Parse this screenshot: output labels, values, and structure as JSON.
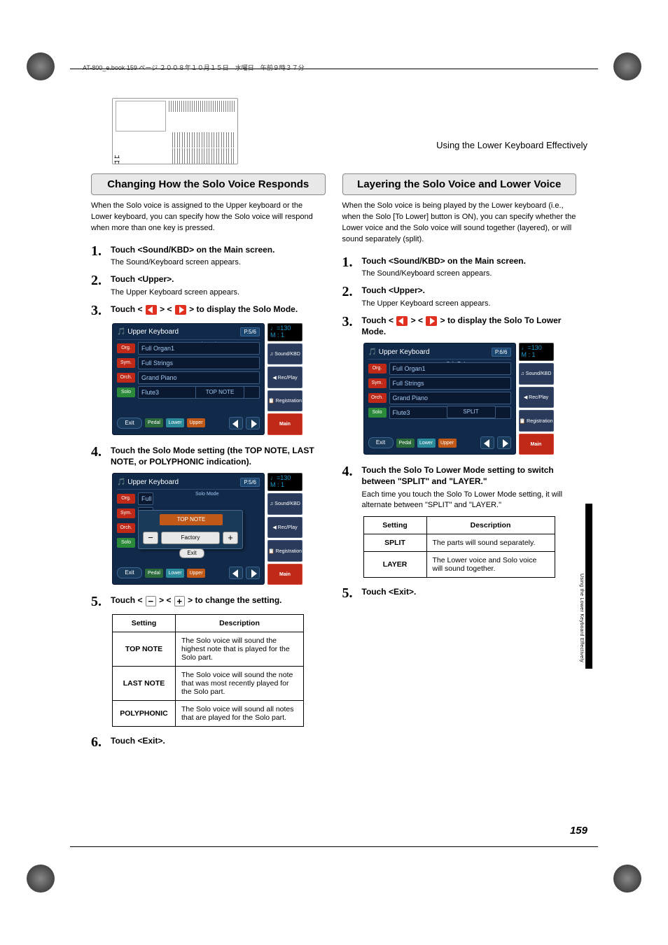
{
  "header_text": "AT-800_e.book  159 ページ  ２００８年１０月１５日　水曜日　午前９時３７分",
  "section_header": "Using the Lower Keyboard Effectively",
  "side_tab_text": "Using the Lower Keyboard Effectively",
  "page_number": "159",
  "left": {
    "title": "Changing How the Solo Voice Responds",
    "intro": "When the Solo voice is assigned to the Upper keyboard or the Lower keyboard, you can specify how the Solo voice will respond when more than one key is pressed.",
    "steps": [
      {
        "num": "1.",
        "title": "Touch <Sound/KBD> on the Main screen.",
        "body": "The Sound/Keyboard screen appears."
      },
      {
        "num": "2.",
        "title": "Touch <Upper>.",
        "body": "The Upper Keyboard screen appears."
      },
      {
        "num": "3.",
        "title_pre": "Touch < ",
        "title_mid": " > < ",
        "title_post": " > to display the Solo Mode."
      },
      {
        "num": "4.",
        "title": "Touch the Solo Mode setting (the TOP NOTE, LAST NOTE, or POLYPHONIC indication)."
      },
      {
        "num": "5.",
        "title_pre": "Touch < ",
        "title_mid": " > < ",
        "title_post": " > to change the setting."
      },
      {
        "num": "6.",
        "title": "Touch <Exit>."
      }
    ],
    "screenshot1": {
      "header_icon": "♪",
      "header_title": "Upper Keyboard",
      "page_badge": "P.5/6",
      "tempo": "♩=130",
      "tempo_m": "M :     1",
      "col_label": "Solo\nMode",
      "rows": [
        {
          "tag": "Org.",
          "tagclass": "tag-org",
          "voice": "Full Organ1"
        },
        {
          "tag": "Sym.",
          "tagclass": "tag-sym",
          "voice": "Full Strings"
        },
        {
          "tag": "Orch.",
          "tagclass": "tag-orch",
          "voice": "Grand Piano"
        },
        {
          "tag": "Solo",
          "tagclass": "tag-solo",
          "voice": "Flute3"
        }
      ],
      "value": "TOP NOTE",
      "exit": "Exit",
      "mini": {
        "pedal": "Pedal",
        "lower": "Lower",
        "upper": "Upper"
      },
      "side_buttons": [
        {
          "label": "♫ Sound/KBD"
        },
        {
          "label": "◀ Rec/Play"
        },
        {
          "label": "📋 Registration"
        }
      ],
      "main_btn": "Main"
    },
    "screenshot2_popup": {
      "value": "TOP NOTE",
      "factory": "Factory",
      "exit": "Exit"
    },
    "table": {
      "header_setting": "Setting",
      "header_desc": "Description",
      "rows": [
        {
          "key": "TOP NOTE",
          "desc": "The Solo voice will sound the highest note that is played for the Solo part."
        },
        {
          "key": "LAST NOTE",
          "desc": "The Solo voice will sound the note that was most recently played for the Solo part."
        },
        {
          "key": "POLYPHONIC",
          "desc": "The Solo voice will sound all notes that are played for the Solo part."
        }
      ]
    }
  },
  "right": {
    "title": "Layering the Solo Voice and Lower Voice",
    "intro": "When the Solo voice is being played by the Lower keyboard (i.e., when the Solo [To Lower] button is ON), you can specify whether the Lower voice and the Solo voice will sound together (layered), or will sound separately (split).",
    "steps": [
      {
        "num": "1.",
        "title": "Touch <Sound/KBD> on the Main screen.",
        "body": "The Sound/Keyboard screen appears."
      },
      {
        "num": "2.",
        "title": "Touch <Upper>.",
        "body": "The Upper Keyboard screen appears."
      },
      {
        "num": "3.",
        "title_pre": "Touch < ",
        "title_mid": " > < ",
        "title_post": " > to display the Solo To Lower Mode."
      },
      {
        "num": "4.",
        "title": "Touch the Solo To Lower Mode setting to switch between \"SPLIT\" and \"LAYER.\"",
        "body": "Each time you touch the Solo To Lower Mode setting, it will alternate between \"SPLIT\" and \"LAYER.\""
      },
      {
        "num": "5.",
        "title": "Touch <Exit>."
      }
    ],
    "screenshot": {
      "header_title": "Upper Keyboard",
      "page_badge": "P.6/6",
      "tempo": "♩=130",
      "tempo_m": "M :     1",
      "col_label": "Solo To Lower\nMode",
      "rows": [
        {
          "tag": "Org.",
          "tagclass": "tag-org",
          "voice": "Full Organ1"
        },
        {
          "tag": "Sym.",
          "tagclass": "tag-sym",
          "voice": "Full Strings"
        },
        {
          "tag": "Orch.",
          "tagclass": "tag-orch",
          "voice": "Grand Piano"
        },
        {
          "tag": "Solo",
          "tagclass": "tag-solo",
          "voice": "Flute3"
        }
      ],
      "value": "SPLIT",
      "exit": "Exit",
      "mini": {
        "pedal": "Pedal",
        "lower": "Lower",
        "upper": "Upper"
      },
      "side_buttons": [
        {
          "label": "♫ Sound/KBD"
        },
        {
          "label": "◀ Rec/Play"
        },
        {
          "label": "📋 Registration"
        }
      ],
      "main_btn": "Main"
    },
    "table": {
      "header_setting": "Setting",
      "header_desc": "Description",
      "rows": [
        {
          "key": "SPLIT",
          "desc": "The parts will sound separately."
        },
        {
          "key": "LAYER",
          "desc": "The Lower voice and Solo voice will sound together."
        }
      ]
    }
  }
}
